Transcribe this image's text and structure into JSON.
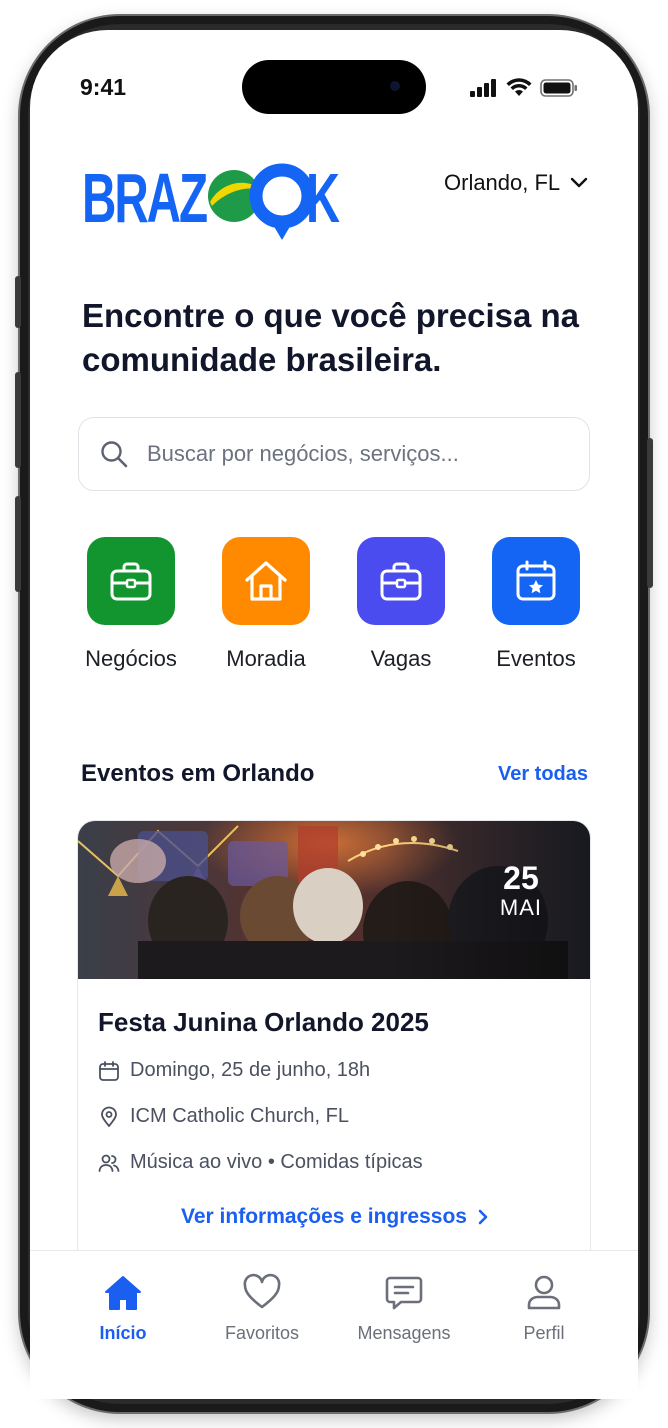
{
  "status_bar": {
    "time": "9:41"
  },
  "header": {
    "brand": "BRAZOOK",
    "location": "Orlando, FL"
  },
  "headline": "Encontre o que você precisa na comunidade brasileira.",
  "search": {
    "placeholder": "Buscar por negócios, serviços..."
  },
  "categories": [
    {
      "label": "Negócios",
      "icon": "briefcase-icon",
      "color": "#12952f"
    },
    {
      "label": "Moradia",
      "icon": "home-icon",
      "color": "#ff8a00"
    },
    {
      "label": "Vagas",
      "icon": "briefcase-icon",
      "color": "#4b4cf0"
    },
    {
      "label": "Eventos",
      "icon": "calendar-star-icon",
      "color": "#1565f5"
    }
  ],
  "events_section": {
    "title": "Eventos em Orlando",
    "see_all": "Ver todas",
    "event": {
      "day": "25",
      "month": "MAI",
      "title": "Festa Junina Orlando 2025",
      "date_text": "Domingo, 25 de junho, 18h",
      "venue": "ICM Catholic Church, FL",
      "tags": "Música ao vivo • Comidas típicas",
      "cta": "Ver informações e ingressos"
    }
  },
  "tab_bar": [
    {
      "label": "Início",
      "icon": "home-filled-icon",
      "active": true
    },
    {
      "label": "Favoritos",
      "icon": "heart-icon",
      "active": false
    },
    {
      "label": "Mensagens",
      "icon": "message-icon",
      "active": false
    },
    {
      "label": "Perfil",
      "icon": "user-icon",
      "active": false
    }
  ],
  "colors": {
    "accent": "#1a5ff0",
    "brand_blue": "#1565f5",
    "brand_green": "#1f9a48",
    "brand_yellow": "#f2d600"
  }
}
